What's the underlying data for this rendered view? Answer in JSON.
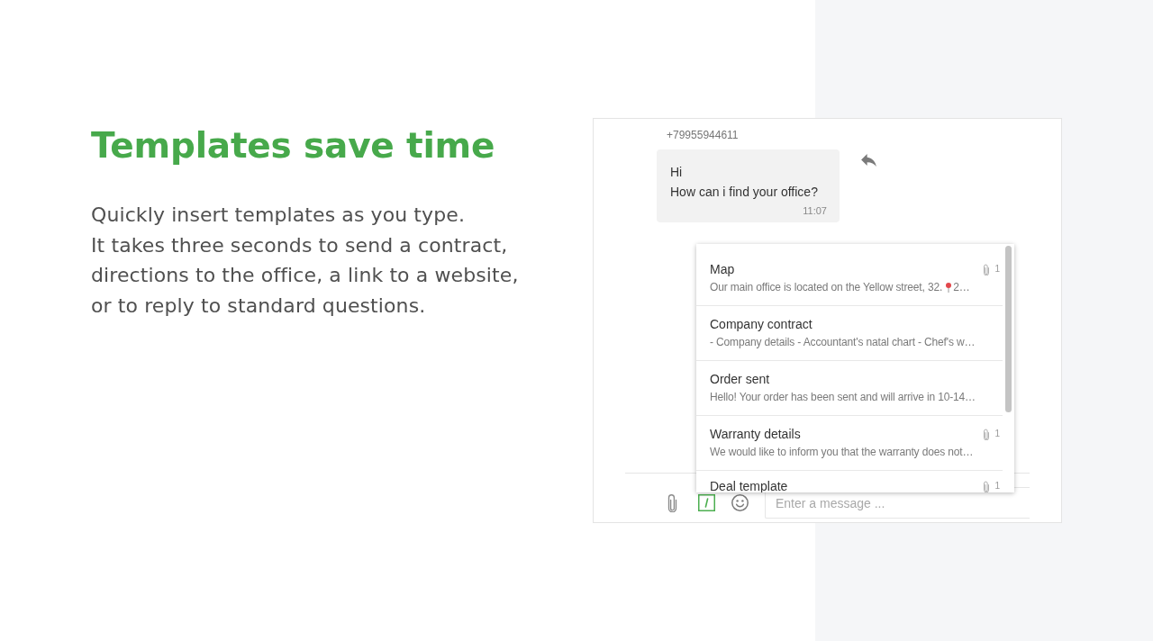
{
  "headline": "Templates save time",
  "description": "Quickly insert templates as you type.\nIt takes three seconds to send a contract,\ndirections to the office, a link to a website,\nor to reply to standard questions.",
  "chat": {
    "sender": "+79955944611",
    "message": {
      "text": "Hi\nHow can i find your office?",
      "time": "11:07"
    },
    "templates": [
      {
        "title": "Map",
        "attachments": "1",
        "preview": [
          {
            "kind": "text",
            "text": "Our main office is located on the Yellow street, 32."
          },
          {
            "kind": "pin"
          },
          {
            "kind": "text",
            "text": "2…"
          }
        ]
      },
      {
        "title": "Company contract",
        "preview": [
          {
            "kind": "text",
            "text": "- Company details - Accountant's natal chart - Chef's w…"
          }
        ]
      },
      {
        "title": "Order sent",
        "preview": [
          {
            "kind": "text",
            "text": "Hello! Your order has been sent and will arrive in 10-14…"
          }
        ]
      },
      {
        "title": "Warranty details",
        "attachments": "1",
        "preview": [
          {
            "kind": "text",
            "text": "We would like to inform you that the warranty does not…"
          }
        ]
      },
      {
        "title": "Deal template",
        "attachments": "1"
      }
    ],
    "composer": {
      "template_active": true,
      "placeholder": "Enter a message ..."
    }
  }
}
